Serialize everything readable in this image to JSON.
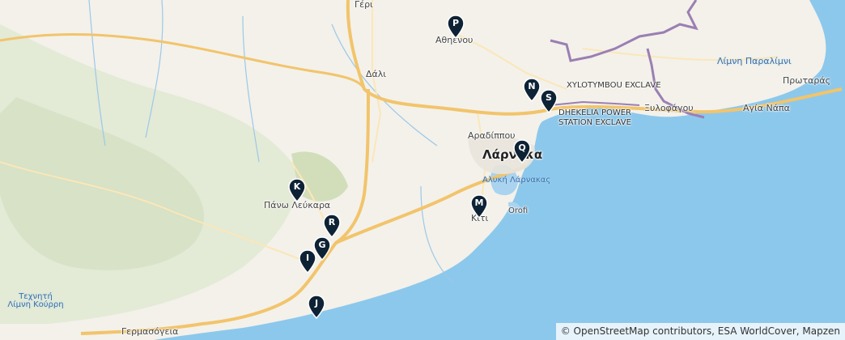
{
  "map": {
    "place_labels": [
      {
        "id": "geri",
        "text": "Γέρι"
      },
      {
        "id": "athienou",
        "text": "Αθηένου"
      },
      {
        "id": "dali",
        "text": "Δάλι"
      },
      {
        "id": "limni-paralimni",
        "text": "Λίμνη Παραλίμνι"
      },
      {
        "id": "protaras",
        "text": "Πρωταράς"
      },
      {
        "id": "xylotymbou",
        "text": "XYLOTYMBOU EXCLAVE"
      },
      {
        "id": "dhekelia",
        "text": "DHEKELIA POWER STATION EXCLAVE"
      },
      {
        "id": "xylofagou",
        "text": "Ξυλοφάγου"
      },
      {
        "id": "agia-napa",
        "text": "Αγία Νάπα"
      },
      {
        "id": "aradippou",
        "text": "Αραδίππου"
      },
      {
        "id": "larnaka",
        "text": "Λάρνακα"
      },
      {
        "id": "aliki",
        "text": "Αλυκή Λάρνακας"
      },
      {
        "id": "oroklini",
        "text": "Orofi"
      },
      {
        "id": "pano-lefkara",
        "text": "Πάνω Λεύκαρα"
      },
      {
        "id": "kiti",
        "text": "Κίτι"
      },
      {
        "id": "kourri",
        "text": "Τεχνητή Λίμνη Κούρρη"
      },
      {
        "id": "germasogeia",
        "text": "Γερμασόγεια"
      }
    ],
    "markers": [
      {
        "id": "P",
        "label": "P"
      },
      {
        "id": "N",
        "label": "N"
      },
      {
        "id": "S",
        "label": "S"
      },
      {
        "id": "Q",
        "label": "Q"
      },
      {
        "id": "K",
        "label": "K"
      },
      {
        "id": "M",
        "label": "M"
      },
      {
        "id": "R",
        "label": "R"
      },
      {
        "id": "G",
        "label": "G"
      },
      {
        "id": "I",
        "label": "I"
      },
      {
        "id": "J",
        "label": "J"
      }
    ],
    "colors": {
      "sea": "#8cc8ec",
      "land": "#f3f1ea",
      "forest": "#dfe8d0",
      "motorway": "#f2c46b",
      "boundary": "#9b7fb3",
      "marker": "#0e2235"
    }
  },
  "attribution": {
    "text": "© OpenStreetMap contributors, ESA WorldCover, Mapzen"
  }
}
